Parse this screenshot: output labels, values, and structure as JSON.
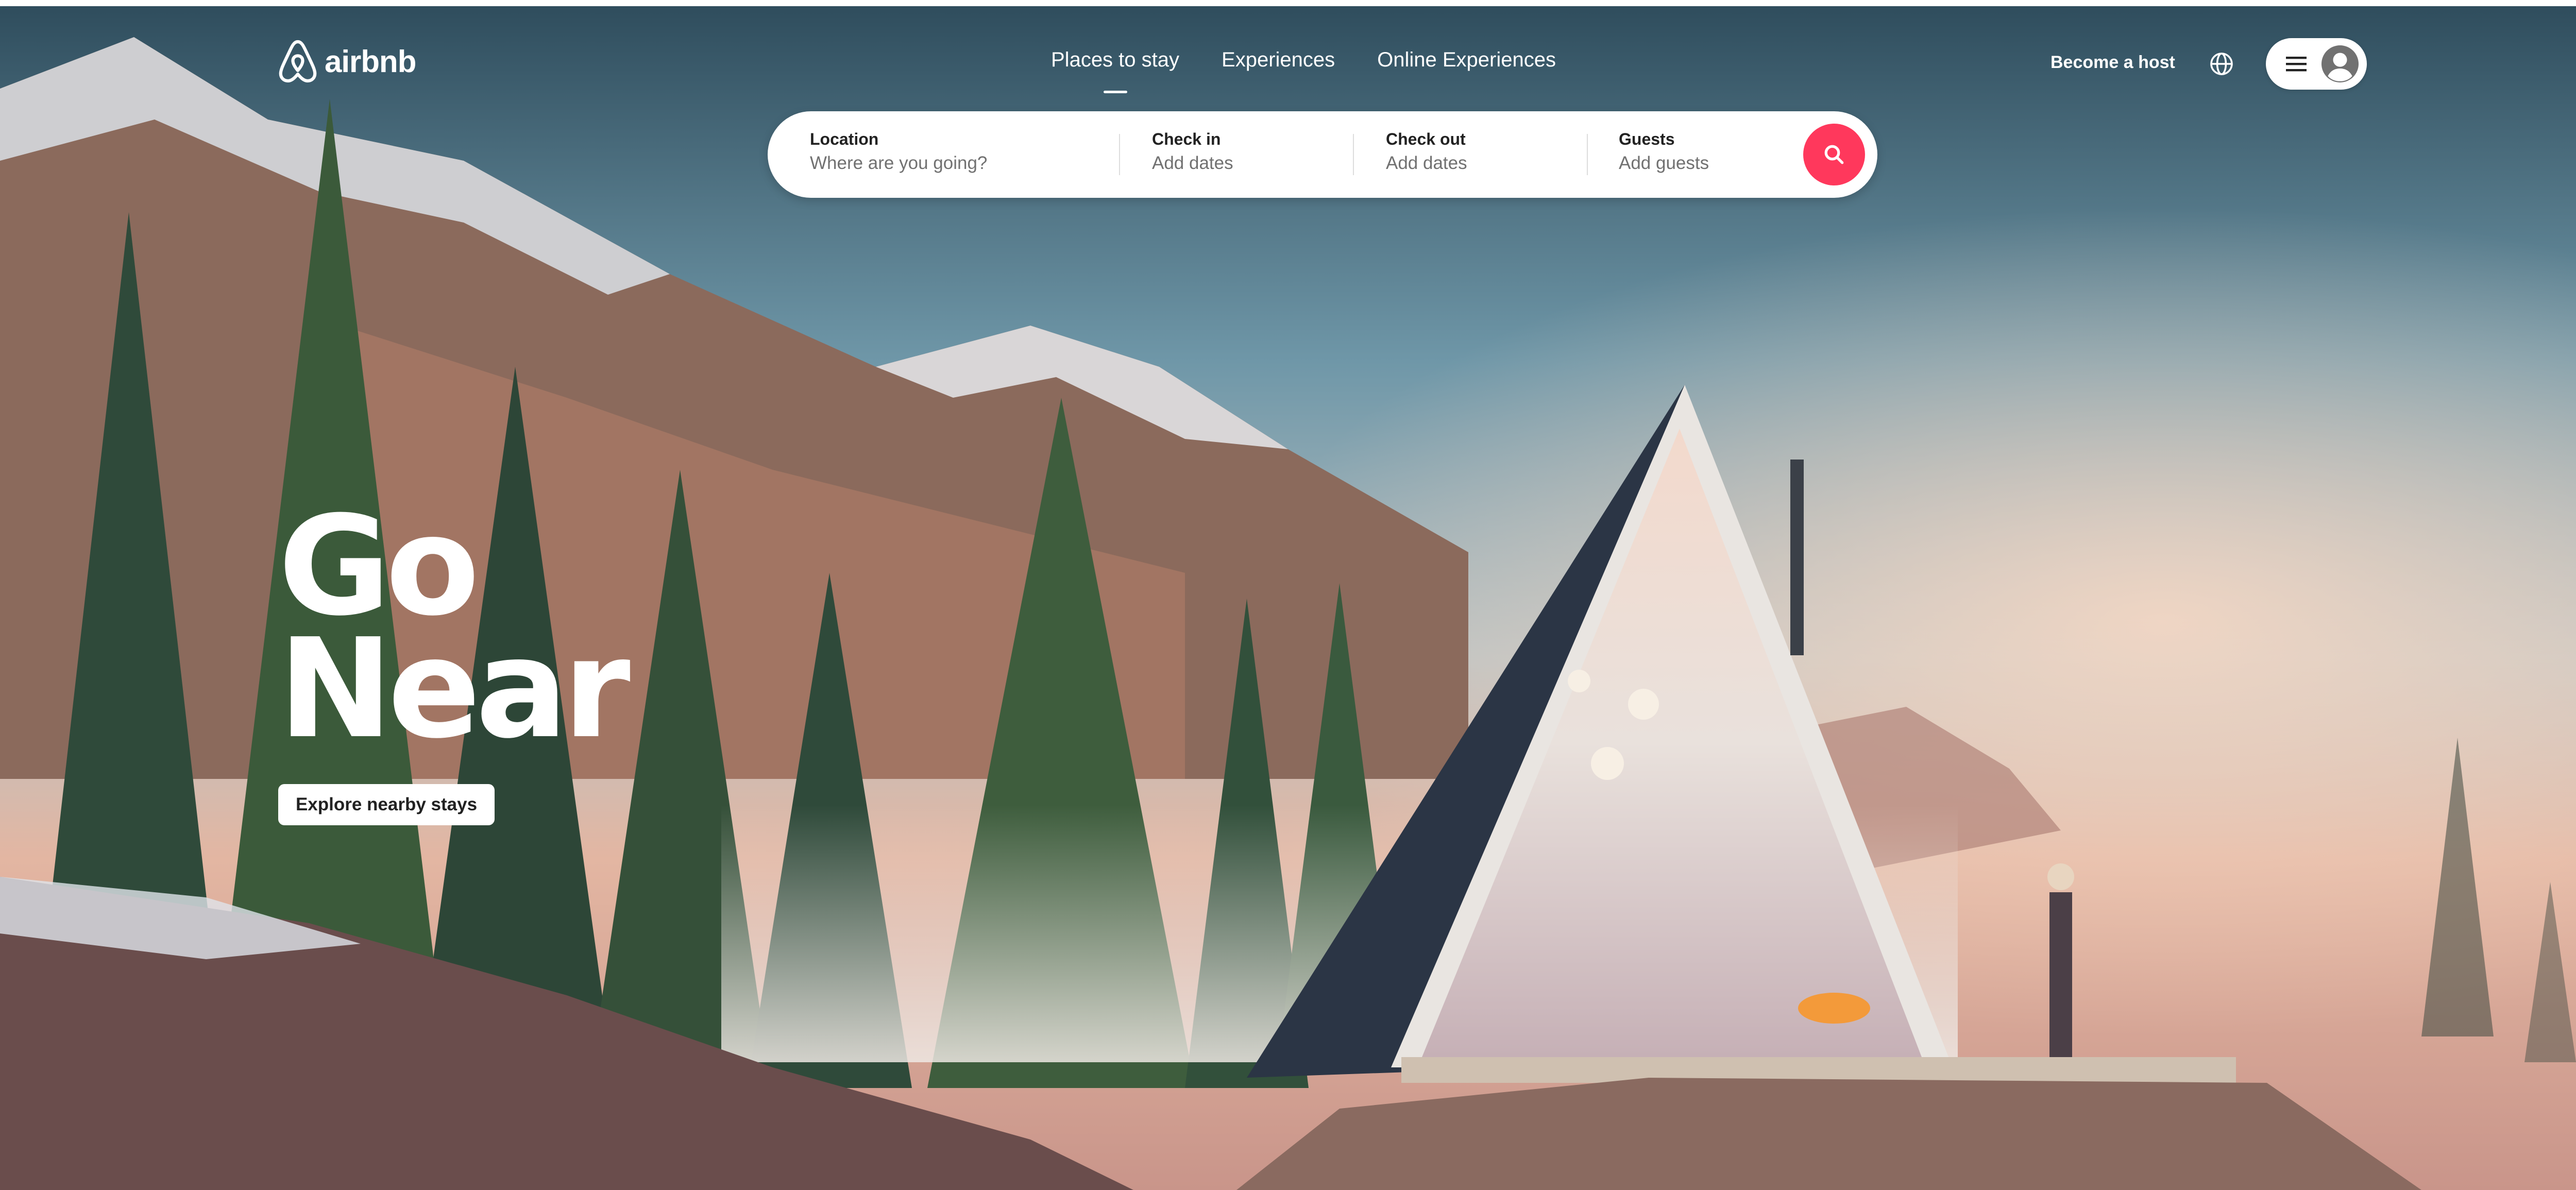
{
  "brand": {
    "name": "airbnb",
    "accent_color": "#ff385c"
  },
  "nav": {
    "tabs": [
      {
        "label": "Places to stay",
        "active": true
      },
      {
        "label": "Experiences",
        "active": false
      },
      {
        "label": "Online Experiences",
        "active": false
      }
    ]
  },
  "header_right": {
    "host_label": "Become a host",
    "globe_icon": "globe-icon",
    "menu_icon": "hamburger-menu-icon",
    "avatar_icon": "user-avatar-icon"
  },
  "search": {
    "location": {
      "label": "Location",
      "placeholder": "Where are you going?"
    },
    "checkin": {
      "label": "Check in",
      "placeholder": "Add dates"
    },
    "checkout": {
      "label": "Check out",
      "placeholder": "Add dates"
    },
    "guests": {
      "label": "Guests",
      "placeholder": "Add guests"
    },
    "button_icon": "search-icon"
  },
  "hero": {
    "title_line1": "Go",
    "title_line2": "Near",
    "cta_label": "Explore nearby stays"
  }
}
